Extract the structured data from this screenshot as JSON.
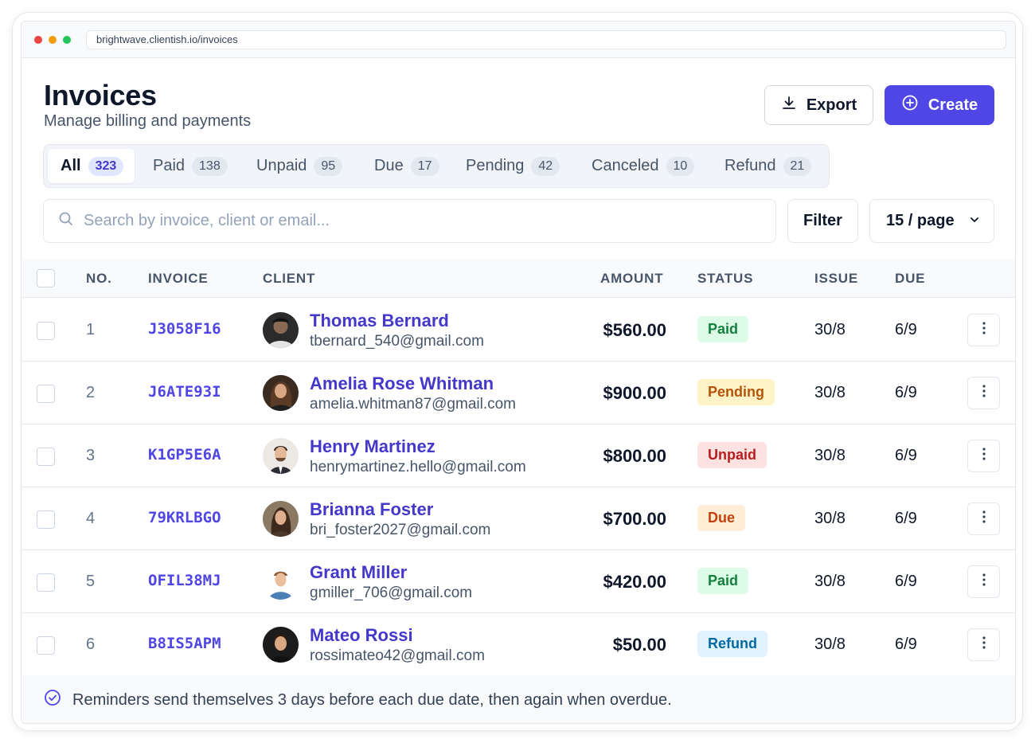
{
  "browser": {
    "url": "brightwave.clientish.io/invoices"
  },
  "header": {
    "title": "Invoices",
    "subtitle": "Manage billing and payments",
    "export_label": "Export",
    "create_label": "Create"
  },
  "tabs": [
    {
      "label": "All",
      "count": "323",
      "active": true
    },
    {
      "label": "Paid",
      "count": "138"
    },
    {
      "label": "Unpaid",
      "count": "95"
    },
    {
      "label": "Due",
      "count": "17"
    },
    {
      "label": "Pending",
      "count": "42"
    },
    {
      "label": "Canceled",
      "count": "10"
    },
    {
      "label": "Refund",
      "count": "21"
    }
  ],
  "search": {
    "placeholder": "Search by invoice, client or email...",
    "value": ""
  },
  "filter_label": "Filter",
  "per_page_label": "15 / page",
  "table": {
    "headers": {
      "no": "NO.",
      "invoice": "INVOICE",
      "client": "CLIENT",
      "amount": "AMOUNT",
      "status": "STATUS",
      "issue": "ISSUE",
      "due": "DUE"
    },
    "rows": [
      {
        "no": "1",
        "invoice": "J3058F16",
        "name": "Thomas Bernard",
        "email": "tbernard_540@gmail.com",
        "amount": "$560.00",
        "status": "Paid",
        "issue": "30/8",
        "due": "6/9"
      },
      {
        "no": "2",
        "invoice": "J6ATE93I",
        "name": "Amelia Rose Whitman",
        "email": "amelia.whitman87@gmail.com",
        "amount": "$900.00",
        "status": "Pending",
        "issue": "30/8",
        "due": "6/9"
      },
      {
        "no": "3",
        "invoice": "K1GP5E6A",
        "name": "Henry Martinez",
        "email": "henrymartinez.hello@gmail.com",
        "amount": "$800.00",
        "status": "Unpaid",
        "issue": "30/8",
        "due": "6/9"
      },
      {
        "no": "4",
        "invoice": "79KRLBGO",
        "name": "Brianna Foster",
        "email": "bri_foster2027@gmail.com",
        "amount": "$700.00",
        "status": "Due",
        "issue": "30/8",
        "due": "6/9"
      },
      {
        "no": "5",
        "invoice": "OFIL38MJ",
        "name": "Grant Miller",
        "email": "gmiller_706@gmail.com",
        "amount": "$420.00",
        "status": "Paid",
        "issue": "30/8",
        "due": "6/9"
      },
      {
        "no": "6",
        "invoice": "B8IS5APM",
        "name": "Mateo Rossi",
        "email": "rossimateo42@gmail.com",
        "amount": "$50.00",
        "status": "Refund",
        "issue": "30/8",
        "due": "6/9"
      }
    ]
  },
  "status_colors": {
    "Paid": {
      "bg": "#dcfce7",
      "fg": "#15803d"
    },
    "Pending": {
      "bg": "#fef3c7",
      "fg": "#b45309"
    },
    "Unpaid": {
      "bg": "#fee2e2",
      "fg": "#b91c1c"
    },
    "Due": {
      "bg": "#ffedd5",
      "fg": "#c2410c"
    },
    "Refund": {
      "bg": "#e0f2fe",
      "fg": "#0369a1"
    }
  },
  "footer": {
    "note": "Reminders send themselves 3 days before each due date, then again when overdue."
  },
  "colors": {
    "accent": "#4f46e5"
  }
}
